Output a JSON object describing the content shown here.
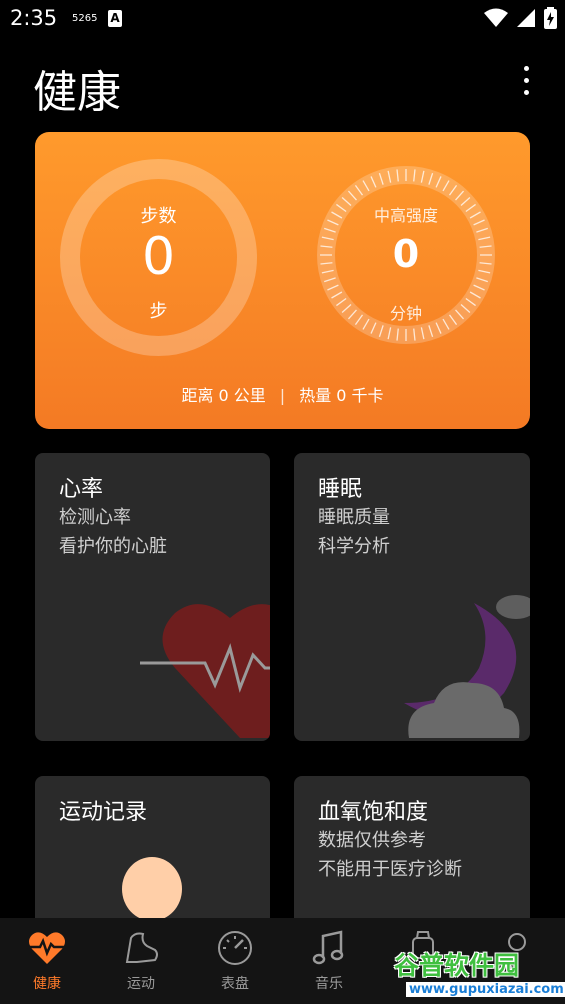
{
  "status_bar": {
    "time": "2:35",
    "indicator": "5265",
    "a_badge": "A"
  },
  "header": {
    "title": "健康"
  },
  "summary": {
    "steps_label": "步数",
    "steps_value": "0",
    "steps_unit": "步",
    "intensity_label": "中高强度",
    "intensity_value": "0",
    "intensity_unit": "分钟",
    "distance_text": "距离 0 公里",
    "separator": "|",
    "calories_text": "热量 0 千卡",
    "gradient_top": "#ff9a2c",
    "gradient_bottom": "#f47a24"
  },
  "cards": {
    "heart": {
      "title": "心率",
      "line1": "检测心率",
      "line2": "看护你的心脏"
    },
    "sleep": {
      "title": "睡眠",
      "line1": "睡眠质量",
      "line2": "科学分析"
    },
    "exercise": {
      "title": "运动记录"
    },
    "spo2": {
      "title": "血氧饱和度",
      "line1": "数据仅供参考",
      "line2": "不能用于医疗诊断"
    }
  },
  "tabs": [
    {
      "label": "健康",
      "icon": "heart-pulse-icon"
    },
    {
      "label": "运动",
      "icon": "shoe-icon"
    },
    {
      "label": "表盘",
      "icon": "dial-icon"
    },
    {
      "label": "音乐",
      "icon": "music-icon"
    },
    {
      "label": "",
      "icon": "watch-icon"
    },
    {
      "label": "",
      "icon": "profile-icon"
    }
  ],
  "watermark": {
    "text": "谷普软件园",
    "url": "www.gupuxiazai.com"
  },
  "colors": {
    "accent": "#ff7a2a",
    "card_bg": "#2a2a2a",
    "background": "#000000"
  }
}
